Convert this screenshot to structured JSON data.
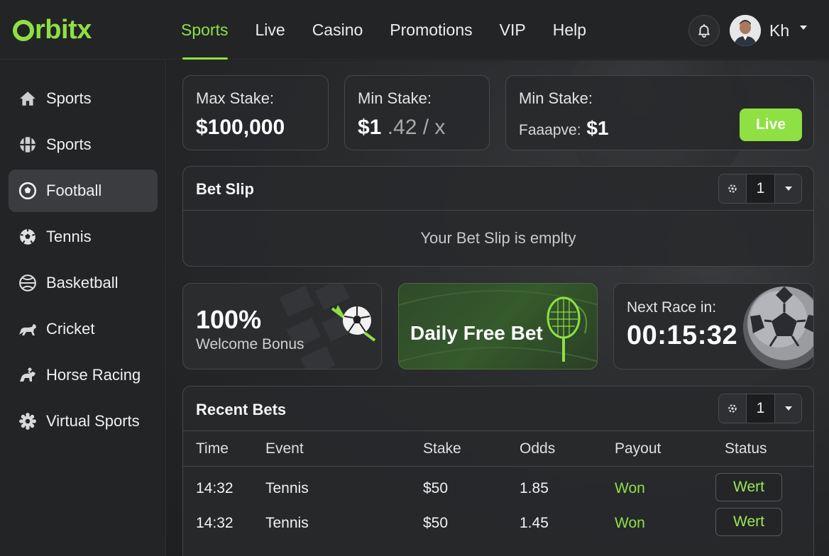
{
  "brand": {
    "logo_text": "rbitx",
    "accent": "#8ee043"
  },
  "header": {
    "tabs": [
      {
        "label": "Sports",
        "active": true
      },
      {
        "label": "Live",
        "active": false
      },
      {
        "label": "Casino",
        "active": false
      },
      {
        "label": "Promotions",
        "active": false
      },
      {
        "label": "VIP",
        "active": false
      },
      {
        "label": "Help",
        "active": false
      }
    ],
    "user": {
      "name": "Kh",
      "avatar_icon": "user-avatar"
    },
    "notification_icon": "bell-icon"
  },
  "sidebar": {
    "items": [
      {
        "label": "Sports",
        "icon": "home-icon",
        "active": false
      },
      {
        "label": "Sports",
        "icon": "grid-ball-icon",
        "active": false
      },
      {
        "label": "Football",
        "icon": "football-icon",
        "active": true
      },
      {
        "label": "Tennis",
        "icon": "soccer-ball-icon",
        "active": false
      },
      {
        "label": "Basketball",
        "icon": "basketball-icon",
        "active": false
      },
      {
        "label": "Cricket",
        "icon": "horse-icon",
        "active": false
      },
      {
        "label": "Horse Racing",
        "icon": "rider-icon",
        "active": false
      },
      {
        "label": "Virtual Sports",
        "icon": "gear-icon",
        "active": false
      }
    ]
  },
  "stats": {
    "max_stake": {
      "label": "Max Stake:",
      "value": "$100,000"
    },
    "min_stake": {
      "label": "Min Stake:",
      "value_main": "$1",
      "value_dim": ".42 / x"
    },
    "min_stake_2": {
      "label": "Min Stake:",
      "value_prefix": "Faaapve:",
      "value_main": "$1",
      "live_label": "Live"
    }
  },
  "bet_slip": {
    "title": "Bet Slip",
    "count": "1",
    "empty_text": "Your Bet Slip is emplty"
  },
  "promos": {
    "welcome": {
      "big": "100%",
      "sub": "Welcome Bonus"
    },
    "free_bet": {
      "title": "Daily Free Bet"
    },
    "race": {
      "label": "Next Race in:",
      "time": "00:15:32"
    }
  },
  "recent_bets": {
    "title": "Recent Bets",
    "count": "1",
    "columns": [
      "Time",
      "Event",
      "Stake",
      "Odds",
      "Payout",
      "Status"
    ],
    "rows": [
      {
        "time": "14:32",
        "event": "Tennis",
        "stake": "$50",
        "odds": "1.85",
        "payout": "Won",
        "status": "Wert"
      },
      {
        "time": "14:32",
        "event": "Tennis",
        "stake": "$50",
        "odds": "1.45",
        "payout": "Won",
        "status": "Wert"
      }
    ]
  }
}
